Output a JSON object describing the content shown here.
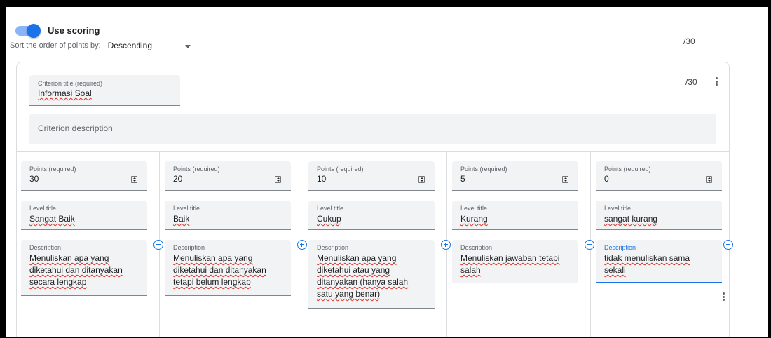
{
  "scoring": {
    "label": "Use scoring",
    "enabled": true
  },
  "sort": {
    "label": "Sort the order of points by:",
    "value": "Descending"
  },
  "total_points": "/30",
  "criterion": {
    "title_label": "Criterion title (required)",
    "title_value": "Informasi Soal",
    "total": "/30",
    "description_placeholder": "Criterion description",
    "levels": [
      {
        "points_label": "Points (required)",
        "points": "30",
        "title_label": "Level title",
        "title": "Sangat Baik",
        "desc_label": "Description",
        "desc": "Menuliskan apa yang diketahui dan ditanyakan secara lengkap"
      },
      {
        "points_label": "Points (required)",
        "points": "20",
        "title_label": "Level title",
        "title": "Baik",
        "desc_label": "Description",
        "desc": "Menuliskan apa yang diketahui dan ditanyakan tetapi belum lengkap"
      },
      {
        "points_label": "Points (required)",
        "points": "10",
        "title_label": "Level title",
        "title": "Cukup",
        "desc_label": "Description",
        "desc": "Menuliskan apa yang diketahui atau yang ditanyakan (hanya salah satu yang benar)"
      },
      {
        "points_label": "Points (required)",
        "points": "5",
        "title_label": "Level title",
        "title": "Kurang",
        "desc_label": "Description",
        "desc": "Menuliskan jawaban tetapi salah"
      },
      {
        "points_label": "Points (required)",
        "points": "0",
        "title_label": "Level title",
        "title": "sangat kurang",
        "desc_label": "Description",
        "desc": "tidak menuliskan sama sekali"
      }
    ]
  },
  "colors": {
    "accent": "#1a73e8",
    "toggle_track": "#8ab4f8",
    "field_bg": "#f1f3f4",
    "spellcheck": "#d93025"
  }
}
